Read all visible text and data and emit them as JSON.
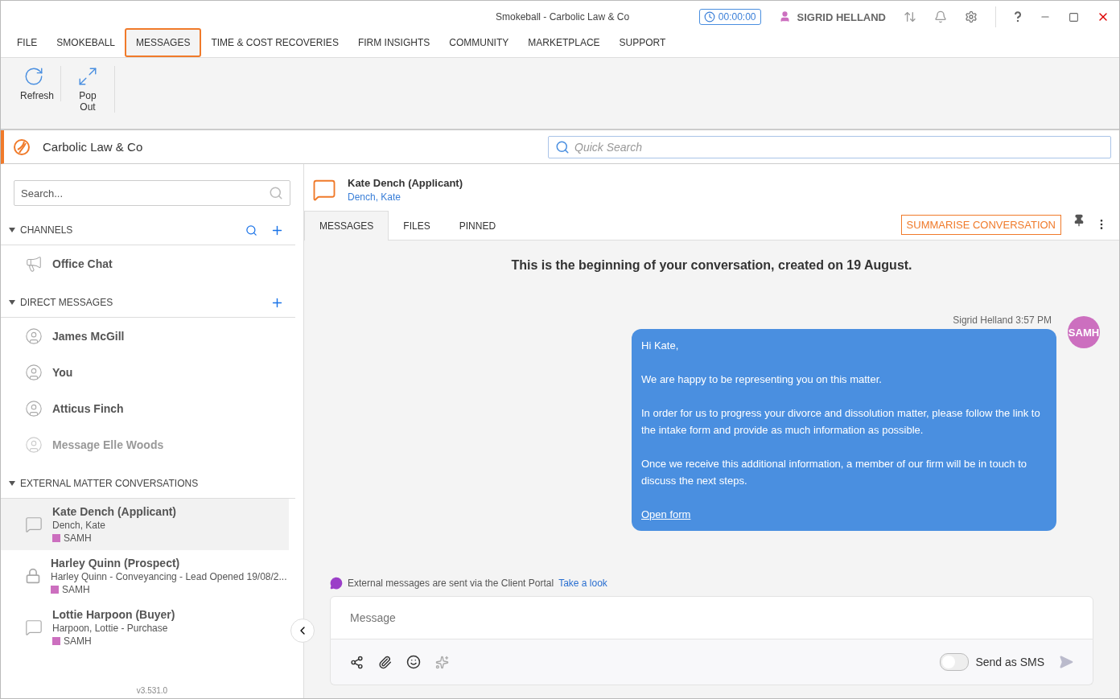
{
  "window": {
    "title": "Smokeball  - Carbolic Law & Co",
    "timer": "00:00:00",
    "user": "SIGRID HELLAND"
  },
  "menu": [
    {
      "label": "FILE",
      "selected": false
    },
    {
      "label": "SMOKEBALL",
      "selected": false
    },
    {
      "label": "MESSAGES",
      "selected": true
    },
    {
      "label": "TIME & COST RECOVERIES",
      "selected": false
    },
    {
      "label": "FIRM INSIGHTS",
      "selected": false
    },
    {
      "label": "COMMUNITY",
      "selected": false
    },
    {
      "label": "MARKETPLACE",
      "selected": false
    },
    {
      "label": "SUPPORT",
      "selected": false
    }
  ],
  "ribbon": [
    {
      "label": "Refresh",
      "kind": "refresh"
    },
    {
      "label": "Pop Out",
      "kind": "popout"
    }
  ],
  "firm_bar": {
    "name": "Carbolic Law & Co",
    "search_placeholder": "Quick Search"
  },
  "sidebar": {
    "search_placeholder": "Search...",
    "sections": [
      {
        "title": "CHANNELS",
        "kind": "channels",
        "items": [
          {
            "name": "Office Chat",
            "dimmed": false
          }
        ]
      },
      {
        "title": "DIRECT MESSAGES",
        "kind": "direct",
        "items": [
          {
            "name": "James McGill",
            "dimmed": false
          },
          {
            "name": "You",
            "dimmed": false
          },
          {
            "name": "Atticus Finch",
            "dimmed": false
          },
          {
            "name": "Message Elle Woods",
            "dimmed": true
          }
        ]
      },
      {
        "title": "EXTERNAL MATTER CONVERSATIONS",
        "kind": "external",
        "items": [
          {
            "name": "Kate Dench (Applicant)",
            "subtitle": "Dench, Kate",
            "tag": "SAMH",
            "color": "#cc6fbf",
            "kind": "chat",
            "selected": true
          },
          {
            "name": "Harley Quinn (Prospect)",
            "subtitle": "Harley Quinn - Conveyancing - Lead Opened 19/08/2...",
            "tag": "SAMH",
            "color": "#cc6fbf",
            "kind": "locked",
            "selected": false
          },
          {
            "name": "Lottie Harpoon (Buyer)",
            "subtitle": "Harpoon, Lottie - Purchase",
            "tag": "SAMH",
            "color": "#cc6fbf",
            "kind": "chat",
            "selected": false
          }
        ]
      }
    ],
    "version": "v3.531.0"
  },
  "conversation": {
    "title": "Kate Dench (Applicant)",
    "subtitle": "Dench, Kate",
    "tabs": [
      {
        "label": "MESSAGES",
        "selected": true
      },
      {
        "label": "FILES",
        "selected": false
      },
      {
        "label": "PINNED",
        "selected": false
      }
    ],
    "summarise_button": "SUMMARISE CONVERSATION",
    "banner": "This is the beginning of your conversation, created on 19 August.",
    "messages": [
      {
        "author": "Sigrid Helland",
        "time": "3:57 PM",
        "avatar": "SAMH",
        "paragraphs": [
          "Hi Kate,",
          "We are happy to be representing you on this matter.",
          "In order for us to progress your divorce and dissolution matter, please follow the link to the intake form and provide as much information as possible.",
          "Once we receive this additional information, a member of our firm will be in touch to discuss the next steps."
        ],
        "link": "Open form"
      }
    ],
    "notice": "External messages are sent via the Client Portal",
    "notice_link": "Take a look",
    "composer_placeholder": "Message",
    "sms": {
      "label": "Send as SMS",
      "on": false
    }
  }
}
